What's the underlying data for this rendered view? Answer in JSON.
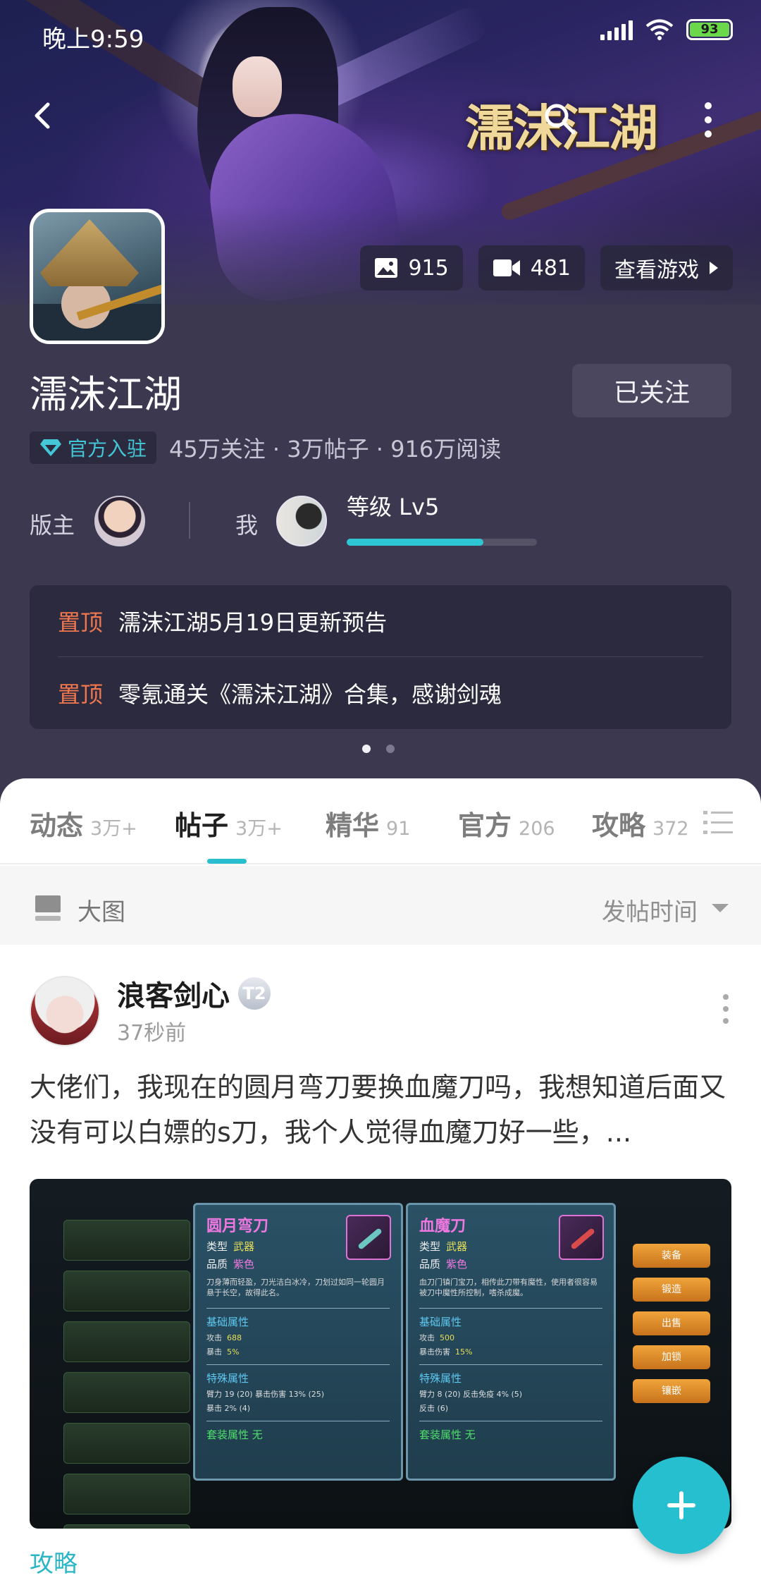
{
  "status_bar": {
    "time": "晚上9:59",
    "battery": "93"
  },
  "header": {
    "logo_text": "濡沫江湖"
  },
  "stats": {
    "images": "915",
    "videos": "481",
    "view_game_label": "查看游戏"
  },
  "forum": {
    "title": "濡沫江湖",
    "follow_label": "已关注",
    "official_label": "官方入驻",
    "info": "45万关注 · 3万帖子 · 916万阅读",
    "moderator_label": "版主",
    "me_label": "我",
    "level_label": "等级 Lv5",
    "level_progress": 0.72
  },
  "pinned": [
    {
      "tag": "置顶",
      "text": "濡沫江湖5月19日更新预告"
    },
    {
      "tag": "置顶",
      "text": "零氪通关《濡沫江湖》合集，感谢剑魂"
    }
  ],
  "tabs": [
    {
      "label": "动态",
      "count": "3万+"
    },
    {
      "label": "帖子",
      "count": "3万+"
    },
    {
      "label": "精华",
      "count": "91"
    },
    {
      "label": "官方",
      "count": "206"
    },
    {
      "label": "攻略",
      "count": "372"
    }
  ],
  "filter": {
    "view_label": "大图",
    "sort_label": "发帖时间"
  },
  "post": {
    "author": "浪客剑心",
    "badge": "T2",
    "time": "37秒前",
    "text": "大佬们，我现在的圆月弯刀要换血魔刀吗，我想知道后面又没有可以白嫖的s刀，我个人觉得血魔刀好一些，...",
    "category": "攻略",
    "image": {
      "left_card": {
        "name": "圆月弯刀",
        "type_label": "类型",
        "type": "武器",
        "quality_label": "品质",
        "quality": "紫色",
        "desc": "刀身薄而轻盈，刀光洁白冰冷，刀划过如同一轮圆月悬于长空，故得此名。",
        "base_title": "基础属性",
        "attack_label": "攻击",
        "attack": "688",
        "crit_label": "暴击",
        "crit": "5%",
        "special_title": "特殊属性",
        "special_1": "臂力 19 (20)  暴击伤害 13% (25)",
        "special_2": "暴击 2% (4)",
        "set_title": "套装属性 无"
      },
      "right_card": {
        "name": "血魔刀",
        "type_label": "类型",
        "type": "武器",
        "quality_label": "品质",
        "quality": "紫色",
        "desc": "血刀门镇门宝刀，相传此刀带有魔性，使用者很容易被刀中魔性所控制，嗜杀成魔。",
        "base_title": "基础属性",
        "attack_label": "攻击",
        "attack": "500",
        "crit_label": "暴击伤害",
        "crit": "15%",
        "special_title": "特殊属性",
        "special_1": "臂力 8 (20)  反击免疫 4% (5)",
        "special_2": "反击 (6)",
        "set_title": "套装属性 无"
      },
      "actions": [
        "装备",
        "锻造",
        "出售",
        "加锁",
        "镶嵌"
      ]
    }
  },
  "colors": {
    "accent": "#29bfcf",
    "pin_tag": "#f0774e",
    "header_bg": "#3b3850"
  }
}
